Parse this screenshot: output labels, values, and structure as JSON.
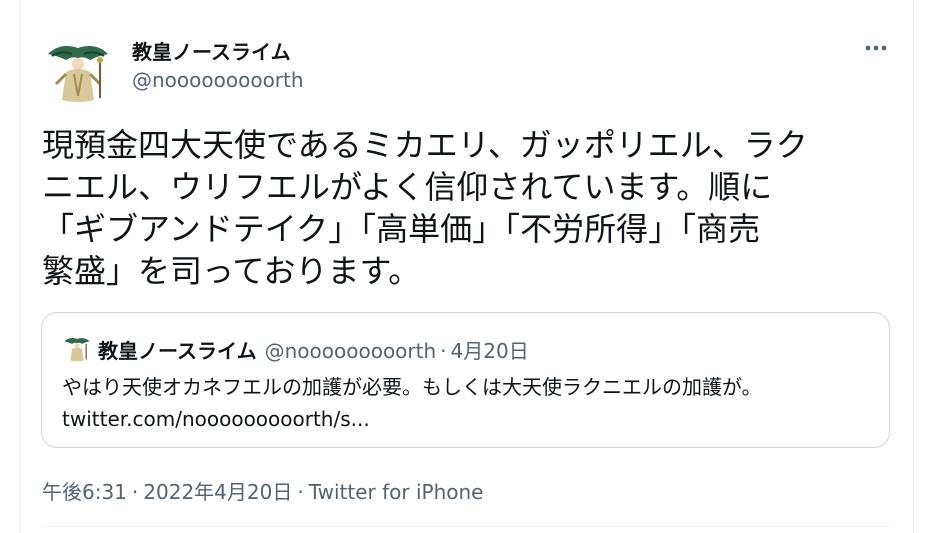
{
  "colors": {
    "text_primary": "#0f1419",
    "text_secondary": "#536471",
    "border": "#cfd9de",
    "divider": "#eff3f4"
  },
  "author": {
    "display_name": "教皇ノースライム",
    "handle": "@nooooooooorth",
    "avatar_icon": "avatar-illustration"
  },
  "more_icon": "more-horizontal-icon",
  "tweet": {
    "lines": [
      "現預金四大天使であるミカエリ、ガッポリエル、ラク",
      "ニエル、ウリフエルがよく信仰されています。順に",
      "「ギブアンドテイク」「高単価」「不労所得」「商売",
      "繁盛」を司っております。"
    ]
  },
  "quote": {
    "display_name": "教皇ノースライム",
    "handle": "@nooooooooorth",
    "separator": "·",
    "date": "4月20日",
    "lines": [
      "やはり天使オカネフエルの加護が必要。もしくは大天使ラクニエルの加護が。",
      "twitter.com/nooooooooorth/s..."
    ]
  },
  "meta": {
    "time": "午後6:31",
    "separator": "·",
    "date": "2022年4月20日",
    "source": "Twitter for iPhone"
  }
}
